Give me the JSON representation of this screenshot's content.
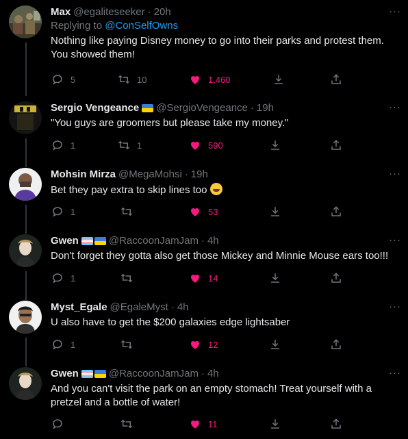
{
  "reply_prefix": "Replying to ",
  "tweets": [
    {
      "name": "Max",
      "handle": "@egaliteseeker",
      "time": "20h",
      "replying_to": "@ConSelfOwns",
      "text_lines": [
        "Nothing like paying Disney money to go into their parks and protest them.",
        "You showed them!"
      ],
      "flags": [],
      "replies": "5",
      "retweets": "10",
      "likes": "1,460"
    },
    {
      "name": "Sergio Vengeance",
      "handle": "@SergioVengeance",
      "time": "19h",
      "text_lines": [
        "\"You guys are groomers but please take my money.\""
      ],
      "flags": [
        "ukraine-flag"
      ],
      "replies": "1",
      "retweets": "1",
      "likes": "590"
    },
    {
      "name": "Mohsin Mirza",
      "handle": "@MegaMohsi",
      "time": "19h",
      "text_lines": [
        "Bet they pay extra to skip lines too"
      ],
      "emoji": "rofl-emoji",
      "flags": [],
      "replies": "1",
      "retweets": "",
      "likes": "53"
    },
    {
      "name": "Gwen",
      "handle": "@RaccoonJamJam",
      "time": "4h",
      "text_lines": [
        "Don't forget they gotta also get those Mickey and Minnie Mouse ears too!!!"
      ],
      "flags": [
        "transgender-flag",
        "ukraine-flag"
      ],
      "replies": "1",
      "retweets": "",
      "likes": "14"
    },
    {
      "name": "Myst_Egale",
      "handle": "@EgaleMyst",
      "time": "4h",
      "text_lines": [
        "U also have to get the $200 galaxies edge lightsaber"
      ],
      "flags": [],
      "replies": "1",
      "retweets": "",
      "likes": "12"
    },
    {
      "name": "Gwen",
      "handle": "@RaccoonJamJam",
      "time": "4h",
      "text_lines": [
        "And you can't visit the park on an empty stomach! Treat yourself with a",
        "pretzel and a bottle of water!"
      ],
      "flags": [
        "transgender-flag",
        "ukraine-flag"
      ],
      "replies": "",
      "retweets": "",
      "likes": "11"
    }
  ],
  "more_label": "···",
  "dot": "·",
  "colors": {
    "background": "#000000",
    "accent": "#1d9bf0",
    "like": "#f91880",
    "muted": "#71767b",
    "text": "#e7e9ea"
  }
}
